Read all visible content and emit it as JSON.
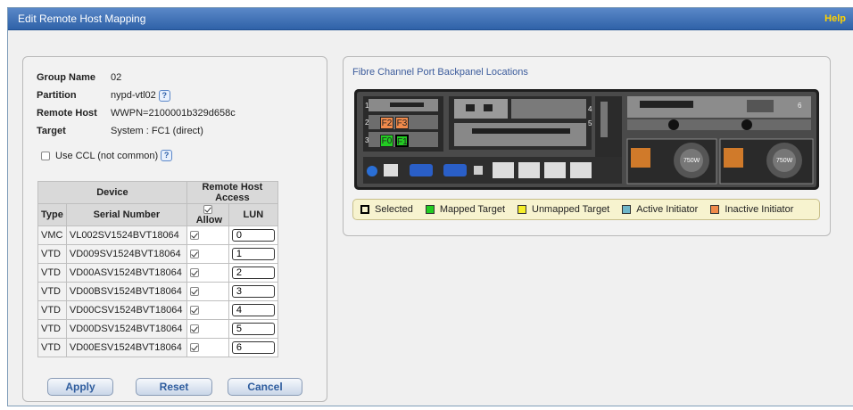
{
  "window": {
    "title": "Edit Remote Host Mapping",
    "help": "Help"
  },
  "info": {
    "group_name": {
      "label": "Group Name",
      "value": "02"
    },
    "partition": {
      "label": "Partition",
      "value": "nypd-vtl02"
    },
    "remote_host": {
      "label": "Remote Host",
      "value": "WWPN=2100001b329d658c"
    },
    "target": {
      "label": "Target",
      "value": "System : FC1 (direct)"
    },
    "use_ccl": {
      "label": "Use CCL (not common)",
      "checked": false
    }
  },
  "table": {
    "group_device": "Device",
    "group_access": "Remote Host Access",
    "col_type": "Type",
    "col_serial": "Serial Number",
    "col_allow": "Allow",
    "col_lun": "LUN",
    "rows": [
      {
        "type": "VMC",
        "serial": "VL002SV1524BVT18064",
        "allow": true,
        "lun": "0"
      },
      {
        "type": "VTD",
        "serial": "VD009SV1524BVT18064",
        "allow": true,
        "lun": "1"
      },
      {
        "type": "VTD",
        "serial": "VD00ASV1524BVT18064",
        "allow": true,
        "lun": "2"
      },
      {
        "type": "VTD",
        "serial": "VD00BSV1524BVT18064",
        "allow": true,
        "lun": "3"
      },
      {
        "type": "VTD",
        "serial": "VD00CSV1524BVT18064",
        "allow": true,
        "lun": "4"
      },
      {
        "type": "VTD",
        "serial": "VD00DSV1524BVT18064",
        "allow": true,
        "lun": "5"
      },
      {
        "type": "VTD",
        "serial": "VD00ESV1524BVT18064",
        "allow": true,
        "lun": "6"
      }
    ]
  },
  "buttons": {
    "apply": "Apply",
    "reset": "Reset",
    "cancel": "Cancel"
  },
  "backpanel": {
    "title": "Fibre Channel Port Backpanel Locations",
    "ports": {
      "f2": "F2",
      "f3": "F3",
      "f0": "F0",
      "f1": "F1"
    },
    "psu_label": "750W",
    "slot_numbers": [
      "1",
      "2",
      "3",
      "4",
      "5",
      "6"
    ]
  },
  "legend": {
    "selected": {
      "label": "Selected",
      "color": "#f7f3cf"
    },
    "mapped": {
      "label": "Mapped Target",
      "color": "#22cc22"
    },
    "unmapped": {
      "label": "Unmapped Target",
      "color": "#f5ee2a"
    },
    "active": {
      "label": "Active Initiator",
      "color": "#6fb6c9"
    },
    "inactive": {
      "label": "Inactive Initiator",
      "color": "#f08a4b"
    }
  }
}
